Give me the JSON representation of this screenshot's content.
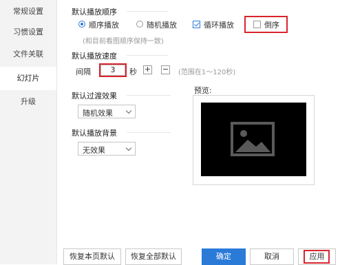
{
  "sidebar": {
    "items": [
      {
        "label": "常规设置"
      },
      {
        "label": "习惯设置"
      },
      {
        "label": "文件关联"
      },
      {
        "label": "幻灯片"
      },
      {
        "label": "升级"
      }
    ]
  },
  "order": {
    "heading": "默认播放顺序",
    "options": {
      "sequential": "顺序播放",
      "random": "随机播放",
      "loop": "循环播放",
      "reverse": "倒序"
    },
    "selected": "顺序播放",
    "loop_checked": true,
    "reverse_checked": false,
    "hint": "(和目前看图顺序保持一致)"
  },
  "speed": {
    "heading": "默认播放速度",
    "interval_label": "间隔",
    "interval_value": "3",
    "unit": "秒",
    "plus": "+",
    "minus": "−",
    "range_hint": "(范围在1～120秒)"
  },
  "transition": {
    "heading": "默认过渡效果",
    "value": "随机效果"
  },
  "background": {
    "heading": "默认播放背景",
    "value": "无效果"
  },
  "preview": {
    "label": "预览:"
  },
  "footer": {
    "restore_page": "恢复本页默认",
    "restore_all": "恢复全部默认",
    "ok": "确定",
    "cancel": "取消",
    "apply": "应用"
  },
  "colors": {
    "accent": "#2a7ad8",
    "highlight_box": "#d9232d"
  }
}
